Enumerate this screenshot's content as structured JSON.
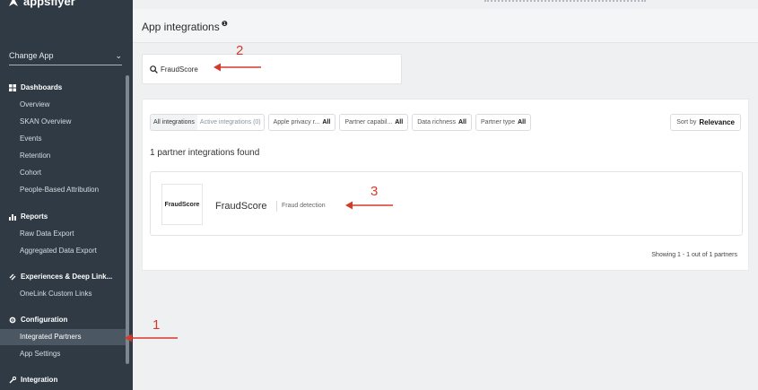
{
  "sidebar": {
    "logo": "appsflyer",
    "change_app": "Change App",
    "sections": [
      {
        "label": "Dashboards",
        "items": [
          "Overview",
          "SKAN Overview",
          "Events",
          "Retention",
          "Cohort",
          "People-Based Attribution"
        ]
      },
      {
        "label": "Reports",
        "items": [
          "Raw Data Export",
          "Aggregated Data Export"
        ]
      },
      {
        "label": "Experiences & Deep Link...",
        "items": [
          "OneLink Custom Links"
        ]
      },
      {
        "label": "Configuration",
        "items": [
          "Integrated Partners",
          "App Settings"
        ]
      },
      {
        "label": "Integration",
        "items": []
      }
    ]
  },
  "header": {
    "title": "App integrations",
    "info_icon": "info-icon"
  },
  "search": {
    "value": "FraudScore"
  },
  "filters": {
    "all_integrations": "All integrations",
    "active_integrations": "Active integrations (0)",
    "apple_privacy": "Apple privacy r...",
    "apple_privacy_value": "All",
    "partner_capability": "Partner capabil...",
    "partner_capability_value": "All",
    "data_richness": "Data richness",
    "data_richness_value": "All",
    "partner_type": "Partner type",
    "partner_type_value": "All",
    "sort_by": "Sort by",
    "sort_value": "Relevance"
  },
  "results": {
    "found_text": "1 partner integrations found",
    "partners": [
      {
        "logo_text": "FraudScore",
        "name": "FraudScore",
        "category": "Fraud detection"
      }
    ],
    "showing": "Showing 1 - 1 out of 1 partners"
  },
  "annotations": [
    "1",
    "2",
    "3"
  ],
  "colors": {
    "sidebar_bg": "#2f3a45",
    "accent_red": "#d33a2c",
    "active_item_bg": "#4b5763"
  }
}
